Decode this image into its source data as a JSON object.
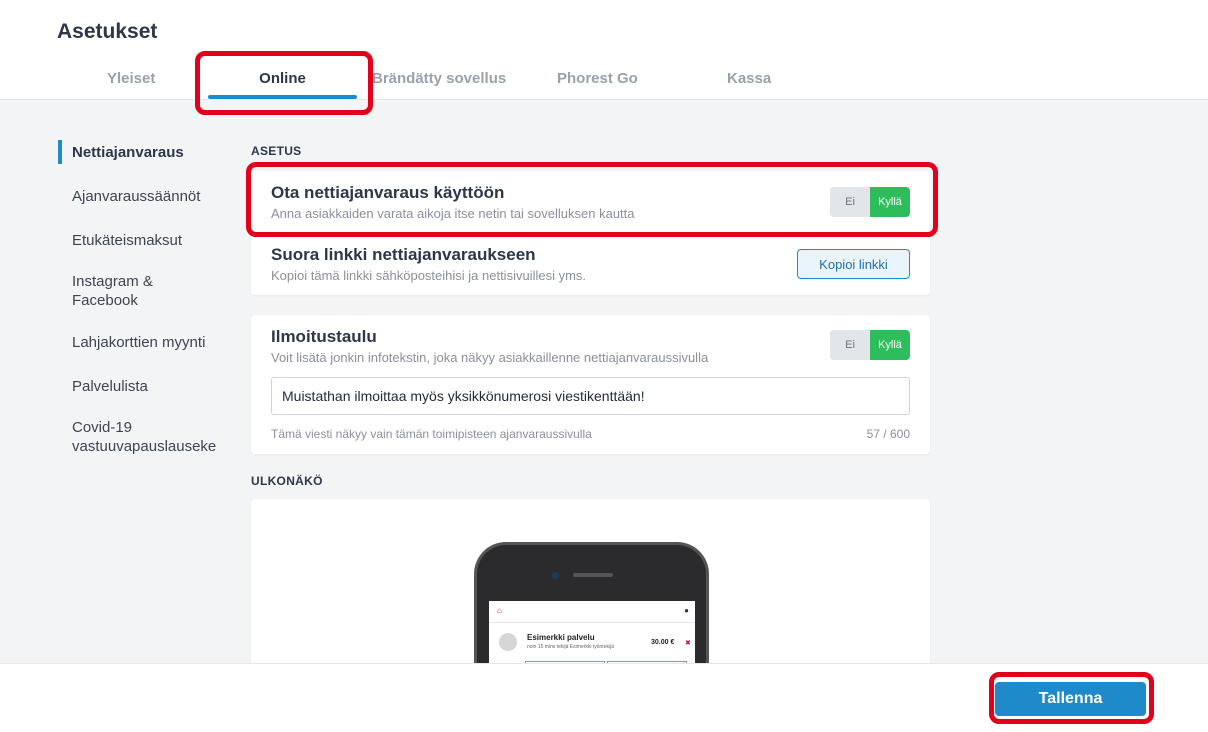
{
  "page": {
    "title": "Asetukset"
  },
  "tabs": [
    {
      "label": "Yleiset",
      "active": false
    },
    {
      "label": "Online",
      "active": true
    },
    {
      "label": "Brändätty sovellus",
      "active": false
    },
    {
      "label": "Phorest Go",
      "active": false
    },
    {
      "label": "Kassa",
      "active": false
    }
  ],
  "sidebar": {
    "items": [
      {
        "label": "Nettiajanvaraus",
        "active": true
      },
      {
        "label": "Ajanvaraussäännöt"
      },
      {
        "label": "Etukäteismaksut"
      },
      {
        "label": "Instagram & Facebook"
      },
      {
        "label": "Lahjakorttien myynti"
      },
      {
        "label": "Palvelulista"
      },
      {
        "label": "Covid-19 vastuuvapauslauseke"
      }
    ]
  },
  "sections": {
    "asetus": "ASETUS",
    "ulkonako": "ULKONÄKÖ"
  },
  "online_booking": {
    "title": "Ota nettiajanvaraus käyttöön",
    "description": "Anna asiakkaiden varata aikoja itse netin tai sovelluksen kautta",
    "toggle": {
      "off_label": "Ei",
      "on_label": "Kyllä",
      "value": "Kyllä"
    }
  },
  "direct_link": {
    "title": "Suora linkki nettiajanvaraukseen",
    "description": "Kopioi tämä linkki sähköposteihisi ja nettisivuillesi yms.",
    "button_label": "Kopioi linkki"
  },
  "notice_board": {
    "title": "Ilmoitustaulu",
    "description": "Voit lisätä jonkin infotekstin, joka näkyy asiakkaillenne nettiajanvaraussivulla",
    "toggle": {
      "off_label": "Ei",
      "on_label": "Kyllä",
      "value": "Kyllä"
    },
    "input_value": "Muistathan ilmoittaa myös yksikkönumerosi viestikenttään!",
    "hint": "Tämä viesti näkyy vain tämän toimipisteen ajanvaraussivulla",
    "counter": "57 / 600"
  },
  "preview": {
    "service_name": "Esimerkki palvelu",
    "service_sub": "noin 15 mins tekijä Esimerkki työntekijä",
    "price": "30.00 €",
    "remove_symbol": "✖"
  },
  "footer": {
    "save_label": "Tallenna"
  },
  "colors": {
    "accent": "#1f8ac9",
    "toggle_on": "#2dbe5b",
    "highlight": "#e3001b"
  }
}
